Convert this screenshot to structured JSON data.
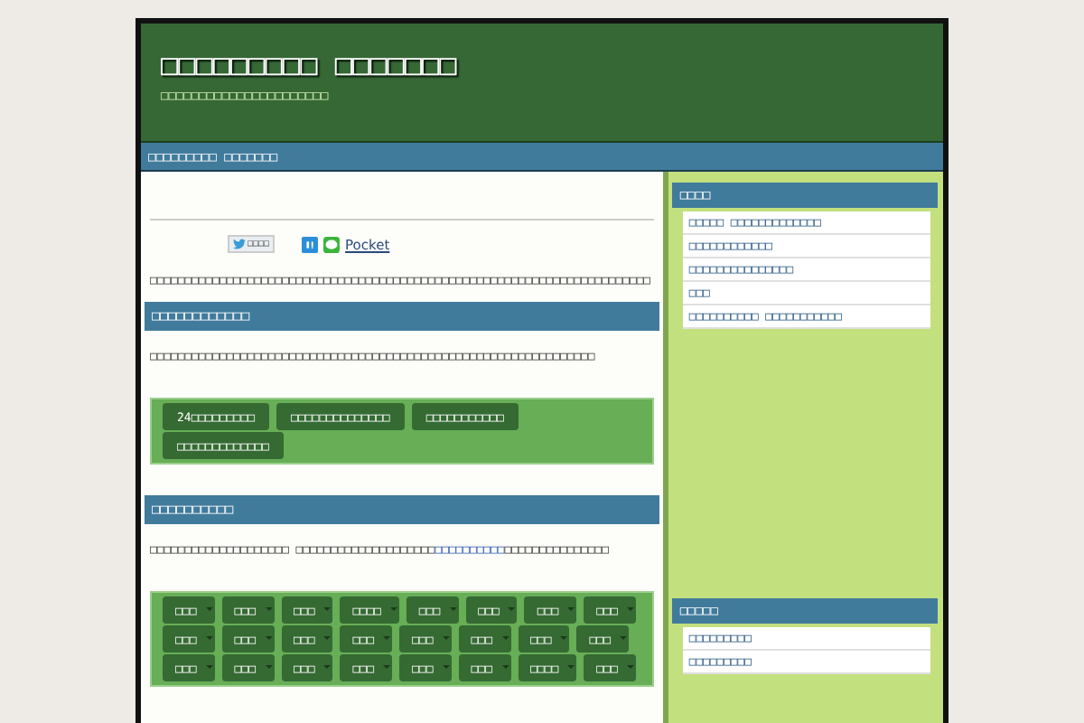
{
  "header": {
    "title": "□□□□□□□□□ □□□□□□□",
    "subtitle": "□□□□□□□□□□□□□□□□□□□□□□"
  },
  "nav": {
    "label": "□□□□□□□□□ □□□□□□□"
  },
  "share": {
    "tweet_label": "□□□□",
    "pocket_label": "Pocket"
  },
  "intro": "□□□□□□□□□□□□□□□□□□□□□□□□□□□□□□□□□□□□□□□□□□□□□□□□□□□□□□□□□□□□□□□□□□□□□□□□",
  "sections": [
    {
      "heading": "□□□□□□□□□□□□",
      "text": [
        {
          "t": "□□□□□□□□□□□□□□□□□□□□□□□□□□□□□□□□□□□□□□□□□□□□□□□□□□□□□□□□□□□□□□□□",
          "link": false
        }
      ],
      "tags": [
        {
          "label": "24□□□□□□□□□",
          "caret": false
        },
        {
          "label": "□□□□□□□□□□□□□□",
          "caret": false
        },
        {
          "label": "□□□□□□□□□□□",
          "caret": false
        },
        {
          "label": "□□□□□□□□□□□□□",
          "caret": false
        }
      ]
    },
    {
      "heading": "□□□□□□□□□□",
      "text": [
        {
          "t": "□□□□□□□□□□□□□□□□□□□□ □□□□□□□□□□□□□□□□□□□□",
          "link": false
        },
        {
          "t": "□□□□□□□□□□",
          "link": true
        },
        {
          "t": "□□□□□□□□□□□□□□□",
          "link": false
        }
      ],
      "tags": [
        {
          "label": "□□□",
          "caret": true
        },
        {
          "label": "□□□",
          "caret": true
        },
        {
          "label": "□□□",
          "caret": true
        },
        {
          "label": "□□□□",
          "caret": true
        },
        {
          "label": "□□□",
          "caret": true
        },
        {
          "label": "□□□",
          "caret": true
        },
        {
          "label": "□□□",
          "caret": true
        },
        {
          "label": "□□□",
          "caret": true
        },
        {
          "label": "□□□",
          "caret": true
        },
        {
          "label": "□□□",
          "caret": true
        },
        {
          "label": "□□□",
          "caret": true
        },
        {
          "label": "□□□",
          "caret": true
        },
        {
          "label": "□□□",
          "caret": true
        },
        {
          "label": "□□□",
          "caret": true
        },
        {
          "label": "□□□",
          "caret": true
        },
        {
          "label": "□□□",
          "caret": true
        },
        {
          "label": "□□□",
          "caret": true
        },
        {
          "label": "□□□",
          "caret": true
        },
        {
          "label": "□□□",
          "caret": true
        },
        {
          "label": "□□□",
          "caret": true
        },
        {
          "label": "□□□",
          "caret": true
        },
        {
          "label": "□□□",
          "caret": true
        },
        {
          "label": "□□□□",
          "caret": true
        },
        {
          "label": "□□□",
          "caret": true
        }
      ]
    }
  ],
  "sidebar": [
    {
      "heading": "□□□□",
      "items": [
        "□□□□□ □□□□□□□□□□□□□",
        "□□□□□□□□□□□□",
        "□□□□□□□□□□□□□□□",
        "□□□",
        "□□□□□□□□□□ □□□□□□□□□□□"
      ]
    },
    {
      "heading": "□□□□□",
      "items": [
        "□□□□□□□□□",
        "□□□□□□□□□"
      ]
    }
  ]
}
